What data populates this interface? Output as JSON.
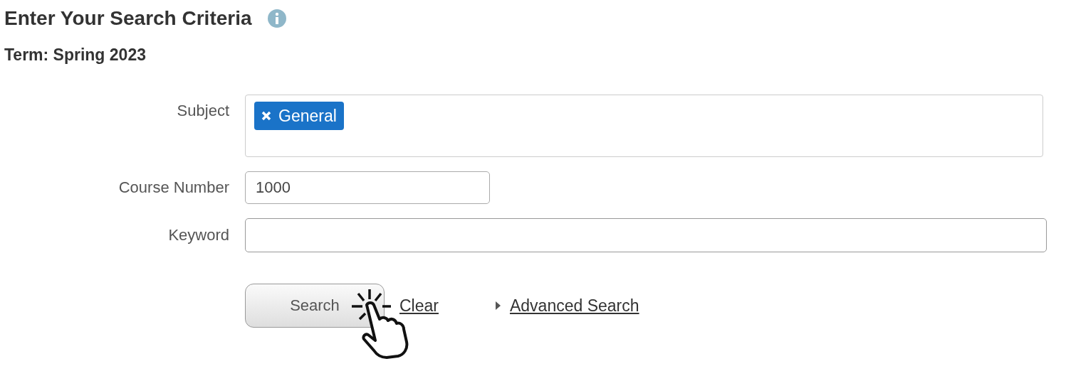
{
  "heading": {
    "title": "Enter Your Search Criteria"
  },
  "term": "Term: Spring 2023",
  "fields": [
    {
      "kind": "tags",
      "label": "Subject",
      "tags": [
        "General"
      ]
    },
    {
      "kind": "short",
      "label": "Course Number",
      "value": "1000"
    },
    {
      "kind": "wide",
      "label": "Keyword"
    }
  ],
  "actions": {
    "search": "Search",
    "clear": "Clear",
    "advanced": {
      "label": "Advanced Search",
      "expanded": false
    }
  }
}
